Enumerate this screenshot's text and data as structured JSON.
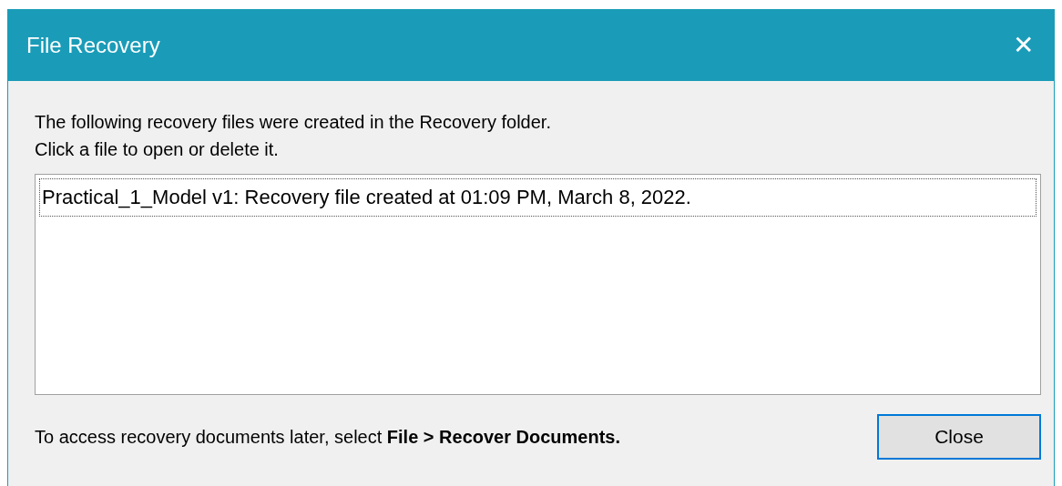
{
  "window": {
    "title": "File Recovery",
    "close": "✕"
  },
  "intro": [
    "The following recovery files were created in the Recovery folder.",
    "Click a file to open or delete it."
  ],
  "files": [
    {
      "label": "Practical_1_Model v1: Recovery file created at 01:09 PM, March 8, 2022.",
      "focused": true
    }
  ],
  "footer": {
    "hint": "To access recovery documents later, select **File > Recover Documents.**",
    "button": "Close"
  }
}
